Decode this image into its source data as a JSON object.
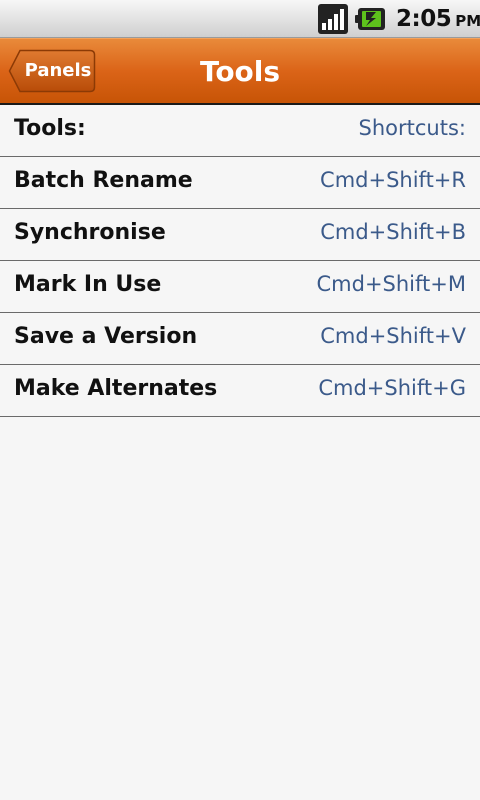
{
  "status_bar": {
    "time": "2:05",
    "ampm": "PM"
  },
  "header": {
    "back_label": "Panels",
    "title": "Tools"
  },
  "table": {
    "header": {
      "name": "Tools:",
      "shortcut": "Shortcuts:"
    },
    "rows": [
      {
        "name": "Batch Rename",
        "shortcut": "Cmd+Shift+R"
      },
      {
        "name": "Synchronise",
        "shortcut": "Cmd+Shift+B"
      },
      {
        "name": "Mark In Use",
        "shortcut": "Cmd+Shift+M"
      },
      {
        "name": "Save a Version",
        "shortcut": "Cmd+Shift+V"
      },
      {
        "name": "Make Alternates",
        "shortcut": "Cmd+Shift+G"
      }
    ]
  },
  "colors": {
    "header_orange": "#db6418",
    "shortcut_text": "#3b5a8a"
  }
}
